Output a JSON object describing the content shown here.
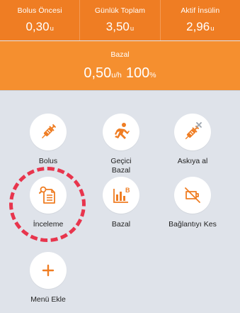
{
  "header": {
    "stats": [
      {
        "label": "Bolus Öncesi",
        "value": "0,30",
        "unit": "u"
      },
      {
        "label": "Günlük Toplam",
        "value": "3,50",
        "unit": "u"
      },
      {
        "label": "Aktif İnsülin",
        "value": "2,96",
        "unit": "u"
      }
    ],
    "basal": {
      "label": "Bazal",
      "value": "0,50",
      "unit": "u/h",
      "percent": "100",
      "percent_unit": "%"
    }
  },
  "menu": {
    "items": [
      {
        "label": "Bolus",
        "icon": "syringe-icon"
      },
      {
        "label": "Geçici\nBazal",
        "icon": "running-person-icon"
      },
      {
        "label": "Askıya al",
        "icon": "syringe-cancel-icon"
      },
      {
        "label": "İnceleme",
        "icon": "document-review-icon"
      },
      {
        "label": "Bazal",
        "icon": "bar-chart-basal-icon"
      },
      {
        "label": "Bağlantıyı Kes",
        "icon": "disconnect-icon"
      },
      {
        "label": "Menü Ekle",
        "icon": "plus-icon"
      }
    ]
  },
  "colors": {
    "header_dark": "#ef7d23",
    "header_basal": "#f58f2f",
    "accent": "#ef7d23",
    "background": "#dfe3ea",
    "highlight": "#e8354d"
  }
}
